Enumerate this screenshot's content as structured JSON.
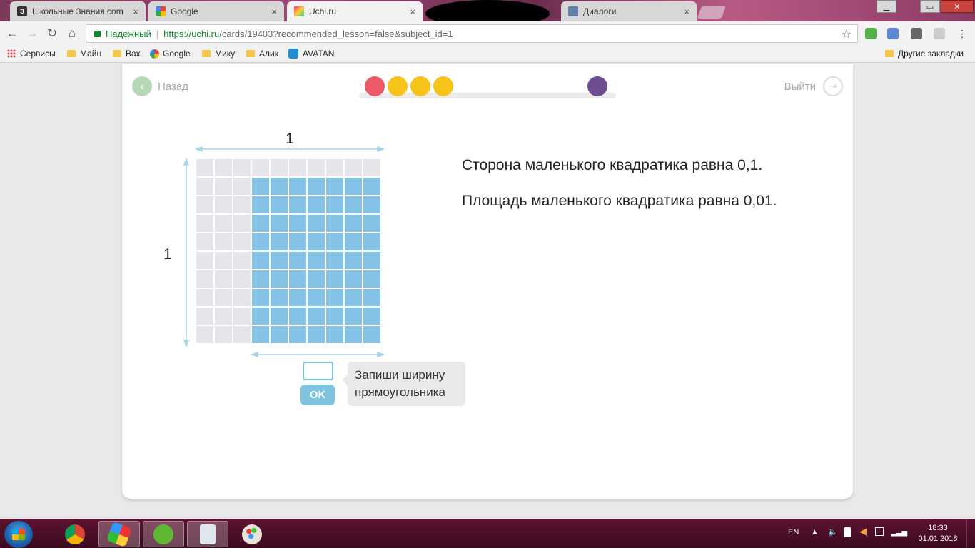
{
  "browser": {
    "tabs": [
      {
        "title": "Школьные Знания.com",
        "favicon": "brainly-icon",
        "active": false
      },
      {
        "title": "Google",
        "favicon": "google-icon",
        "active": false
      },
      {
        "title": "Uchi.ru",
        "favicon": "uchi-icon",
        "active": true
      },
      {
        "title": "Диалоги",
        "favicon": "vk-icon",
        "active": false
      }
    ],
    "close_glyph": "×",
    "address": {
      "secure_label": "Надежный",
      "url_origin": "https://uchi.ru",
      "url_path": "/cards/19403?recommended_lesson=false&subject_id=1"
    },
    "bookmarks": [
      {
        "label": "Сервисы",
        "icon": "apps-icon"
      },
      {
        "label": "Майн",
        "icon": "folder-icon"
      },
      {
        "label": "Вах",
        "icon": "folder-icon"
      },
      {
        "label": "Google",
        "icon": "google-icon"
      },
      {
        "label": "Мику",
        "icon": "folder-icon"
      },
      {
        "label": "Алик",
        "icon": "folder-icon"
      },
      {
        "label": "AVATAN",
        "icon": "avatan-icon"
      }
    ],
    "other_bookmarks": "Другие закладки"
  },
  "lesson": {
    "back_label": "Назад",
    "exit_label": "Выйти",
    "progress_dots": [
      {
        "color": "#ec5a69"
      },
      {
        "color": "#f7c31a"
      },
      {
        "color": "#f7c31a"
      },
      {
        "color": "#f7c31a"
      },
      {
        "color": "#6d4c8f"
      }
    ],
    "figure": {
      "top_label": "1",
      "left_label": "1",
      "grid_rows": 10,
      "grid_cols": 10,
      "shaded_cols": 7,
      "shaded_rows": 9,
      "shaded_color": "#86c2e6",
      "empty_color": "#e6e6ea"
    },
    "facts": [
      "Сторона маленького квадратика равна 0,1.",
      "Площадь маленького квадратика равна 0,01."
    ],
    "answer": {
      "value": "",
      "ok_label": "OK"
    },
    "hint": "Запиши ширину прямоугольника"
  },
  "taskbar": {
    "apps": [
      "chrome-icon",
      "bluestacks-icon",
      "utorrent-icon",
      "notepad-icon",
      "paint-icon"
    ],
    "tray": {
      "lang": "EN",
      "time": "18:33",
      "date": "01.01.2018"
    }
  }
}
